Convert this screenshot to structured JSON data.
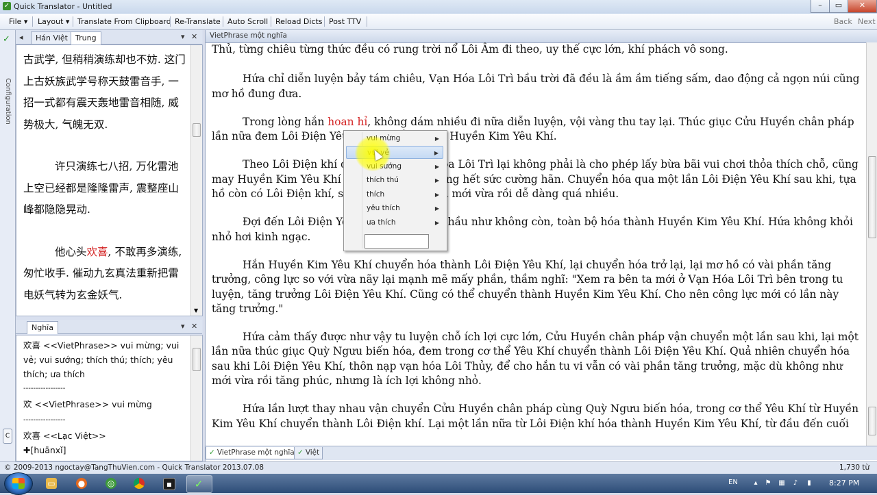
{
  "window": {
    "title": "Quick Translator - Untitled",
    "controls": {
      "minimize": "–",
      "maximize": "▭",
      "close": "✕"
    }
  },
  "toolbar": {
    "items": [
      "File",
      "Layout",
      "Translate From Clipboard",
      "Re-Translate",
      "Auto Scroll",
      "Reload Dicts",
      "Post TTV"
    ],
    "back": "Back",
    "next": "Next"
  },
  "config_strip": {
    "label": "Configuration"
  },
  "left_top": {
    "tabs": [
      "Hán Việt",
      "Trung"
    ],
    "paragraphs": [
      {
        "text": "古武学, 但稍稍演练却也不妨. 这门上古妖族武学号称天鼓雷音手, 一招一式都有震天轰地雷音相随, 威势极大, 气魄无双.",
        "indent": false
      },
      {
        "text": "许只演练七八招, 万化雷池上空已经都是隆隆雷声, 震整座山峰都隐隐晃动.",
        "indent": true
      },
      {
        "before": "他心头",
        "highlight": "欢喜",
        "after": ", 不敢再多演练, 匆忙收手. 催动九玄真法重新把雷电妖气转为玄金妖气.",
        "indent": true
      }
    ]
  },
  "left_bottom": {
    "tab": "Nghĩa",
    "lines": [
      "欢喜 <<VietPhrase>> vui mừng; vui",
      "vẻ; vui sướng; thích thú; thích; yêu",
      "thích; ưa thích",
      "-----------------",
      "欢 <<VietPhrase>> vui mừng",
      "-----------------",
      "欢喜 <<Lạc Việt>>",
      "✚[huānxǐ]"
    ]
  },
  "main": {
    "tab_header": "VietPhrase một nghĩa",
    "p1": "Thủ, từng chiêu từng thức đều có rung trời nổ Lôi Âm đi theo, uy thế cực lớn, khí phách vô song.",
    "p2": "Hứa chỉ diễn luyện bảy tám chiêu, Vạn Hóa Lôi Trì bầu trời đã đều là ầm ầm tiếng sấm, dao động cả ngọn núi cũng mơ hồ đung đưa.",
    "p3_before": "Trong lòng hắn ",
    "p3_highlight": "hoan hỉ",
    "p3_after": ", không dám nhiều đi nữa diễn luyện, vội vàng thu tay lại. Thúc giục Cửu Huyền chân pháp lần nữa đem Lôi Điện Yêu Khí chuyển thành Huyền Kim Yêu Khí.",
    "p4": "Theo Lôi Điện khí chuyển hóa, Vạn Hóa Lôi Trì lại không phải là cho phép lấy bừa bãi vui chơi thỏa thích chỗ, cũng may Huyền Kim Yêu Khí lần nữa cũng cố gắng hết sức cường hãn. Chuyển hóa qua một lần Lôi Điện Yêu Khí sau khi, tựa hồ còn có Lôi Điện khí, so với cho so với hắn mới vừa rồi dễ dàng quá nhiều.",
    "p5": "Đợi đến Lôi Điện Yêu Khí chuyển hóa, hầu như không còn, toàn bộ hóa thành Huyền Kim Yêu Khí. Hứa không khỏi nhỏ hơi kinh ngạc.",
    "p6": "Hắn Huyền Kim Yêu Khí chuyển hóa thành Lôi Điện Yêu Khí, lại chuyển hóa trở lại, lại mơ hồ có vài phần tăng trưởng, công lực so với vừa nãy lại mạnh mẽ mấy phần, thầm nghĩ: \"Xem ra bên ta mới ở Vạn Hóa Lôi Trì bên trong tu luyện, tăng trưởng Lôi Điện Yêu Khí. Cũng có thể chuyển thành Huyền Kim Yêu Khí. Cho nên công lực mới có lần này tăng trưởng.\"",
    "p7": "Hứa cảm thấy được như vậy tu luyện chỗ ích lợi cực lớn, Cửu Huyền chân pháp vận chuyển một lần sau khi, lại một lần nữa thúc giục Quỳ Ngưu biến hóa, đem trong cơ thể Yêu Khí chuyển thành Lôi Điện Yêu Khí. Quả nhiên chuyển hóa sau khi Lôi Điện Yêu Khí, thôn nạp vạn hóa Lôi Thủy, để cho hắn tu vi vẫn có vài phần tăng trưởng, mặc dù không như mới vừa rồi tăng phúc, nhưng là ích lợi không nhỏ.",
    "p8": "Hứa lần lượt thay nhau vận chuyển Cửu Huyền chân pháp cùng Quỳ Ngưu biến hóa, trong cơ thể Yêu Khí từ Huyền Kim Yêu Khí chuyển thành Lôi Điện khí. Lại một lần nữa từ Lôi Điện khí hóa thành Huyền Kim Yêu Khí, từ đầu đến cuối",
    "bottom_tabs": [
      "VietPhrase một nghĩa",
      "Việt"
    ]
  },
  "context_menu": {
    "items": [
      "vui mừng",
      "vui vẻ",
      "vui sướng",
      "thích thú",
      "thích",
      "yêu thích",
      "ưa thích"
    ],
    "hovered": "vui vẻ"
  },
  "status": {
    "left": "© 2009-2013 ngoctay@TangThuVien.com - Quick Translator 2013.07.08",
    "right": "1,730 từ"
  },
  "taskbar": {
    "lang": "EN",
    "time": "8:27 PM"
  },
  "colors": {
    "highlight": "#d32222",
    "menu_hover": "#c5daf4",
    "check_green": "#2c9a2c"
  }
}
